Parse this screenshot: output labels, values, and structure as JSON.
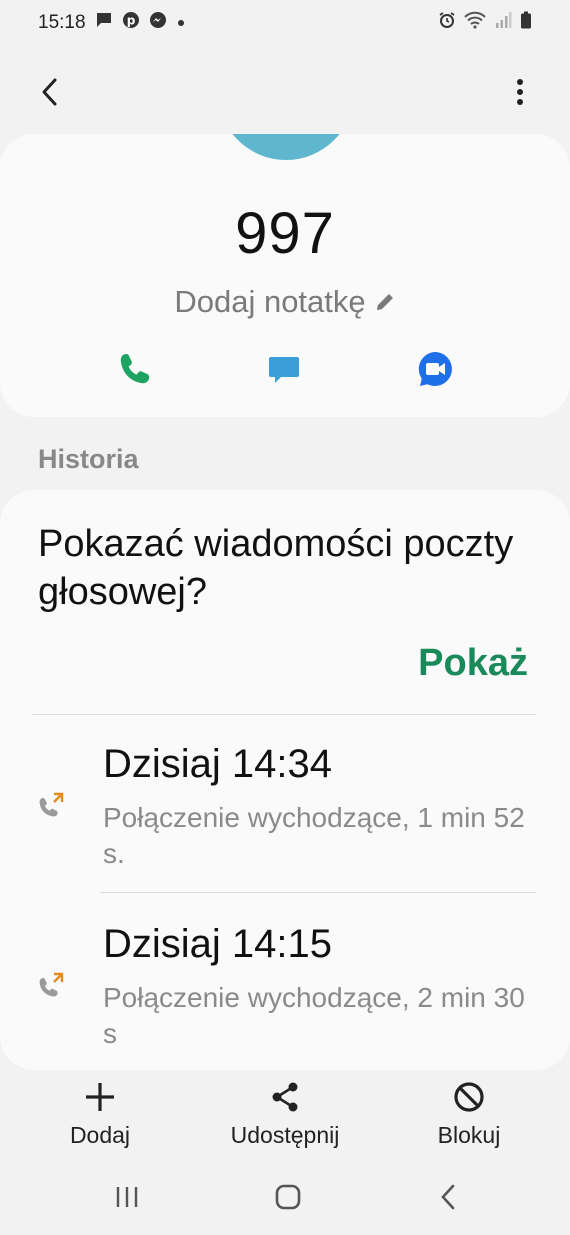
{
  "status_bar": {
    "time": "15:18"
  },
  "contact": {
    "number": "997",
    "note_label": "Dodaj notatkę",
    "avatar_color": "#5fb7cf"
  },
  "history": {
    "section_title": "Historia",
    "voicemail_prompt": "Pokazać wiadomości poczty głosowej?",
    "voicemail_show": "Pokaż",
    "calls": [
      {
        "time": "Dzisiaj 14:34",
        "description": "Połączenie wychodzące, 1 min 52 s."
      },
      {
        "time": "Dzisiaj 14:15",
        "description": "Połączenie wychodzące, 2 min 30 s"
      }
    ]
  },
  "bottom_actions": {
    "add_label": "Dodaj",
    "share_label": "Udostępnij",
    "block_label": "Blokuj"
  },
  "colors": {
    "accent_green": "#1b8a5a",
    "call_green": "#1ea362",
    "message_blue": "#3a9fd8",
    "video_blue": "#1f6fe8",
    "outgoing_arrow": "#e58a1c"
  },
  "icons": {
    "status": [
      "message-icon",
      "pinterest-icon",
      "messenger-icon",
      "dot-icon",
      "alarm-icon",
      "wifi-icon",
      "signal-icon",
      "battery-icon"
    ],
    "actions": [
      "phone-icon",
      "chat-icon",
      "video-icon"
    ]
  }
}
